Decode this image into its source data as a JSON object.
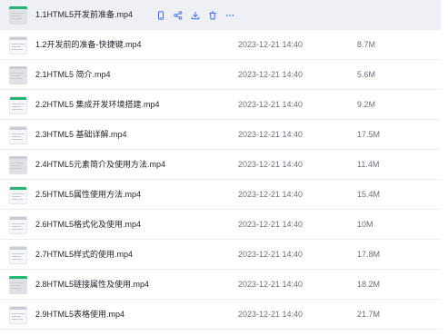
{
  "files": [
    {
      "name": "1.1HTML5开发前准备.mp4",
      "date": "",
      "size": "",
      "thumb": "gray",
      "hover": true
    },
    {
      "name": "1.2开发前的准备-快捷键.mp4",
      "date": "2023-12-21 14:40",
      "size": "8.7M",
      "thumb": "white"
    },
    {
      "name": "2.1HTML5 简介.mp4",
      "date": "2023-12-21 14:40",
      "size": "5.6M",
      "thumb": "gray"
    },
    {
      "name": "2.2HTML5 集成开发环境搭建.mp4",
      "date": "2023-12-21 14:40",
      "size": "9.2M",
      "thumb": "white"
    },
    {
      "name": "2.3HTML5 基础详解.mp4",
      "date": "2023-12-21 14:40",
      "size": "17.5M",
      "thumb": "white"
    },
    {
      "name": "2.4HTML5元素简介及使用方法.mp4",
      "date": "2023-12-21 14:40",
      "size": "11.4M",
      "thumb": "gray"
    },
    {
      "name": "2.5HTML5属性使用方法.mp4",
      "date": "2023-12-21 14:40",
      "size": "15.4M",
      "thumb": "white"
    },
    {
      "name": "2.6HTML5格式化及使用.mp4",
      "date": "2023-12-21 14:40",
      "size": "10M",
      "thumb": "white"
    },
    {
      "name": "2.7HTML5样式的使用.mp4",
      "date": "2023-12-21 14:40",
      "size": "17.8M",
      "thumb": "white"
    },
    {
      "name": "2.8HTML5链接属性及使用.mp4",
      "date": "2023-12-21 14:40",
      "size": "18.2M",
      "thumb": "gray"
    },
    {
      "name": "2.9HTML5表格使用.mp4",
      "date": "2023-12-21 14:40",
      "size": "21.7M",
      "thumb": "white"
    }
  ],
  "row_actions": [
    {
      "icon": "phone-icon",
      "name": "open-on-phone-button"
    },
    {
      "icon": "share-icon",
      "name": "share-button"
    },
    {
      "icon": "download-icon",
      "name": "download-button"
    },
    {
      "icon": "trash-icon",
      "name": "delete-button"
    },
    {
      "icon": "more-icon",
      "name": "more-button"
    }
  ],
  "colors": {
    "accent": "#3b6df5",
    "hover_row": "#eef0f5",
    "thumb_strip": "#22b573"
  }
}
